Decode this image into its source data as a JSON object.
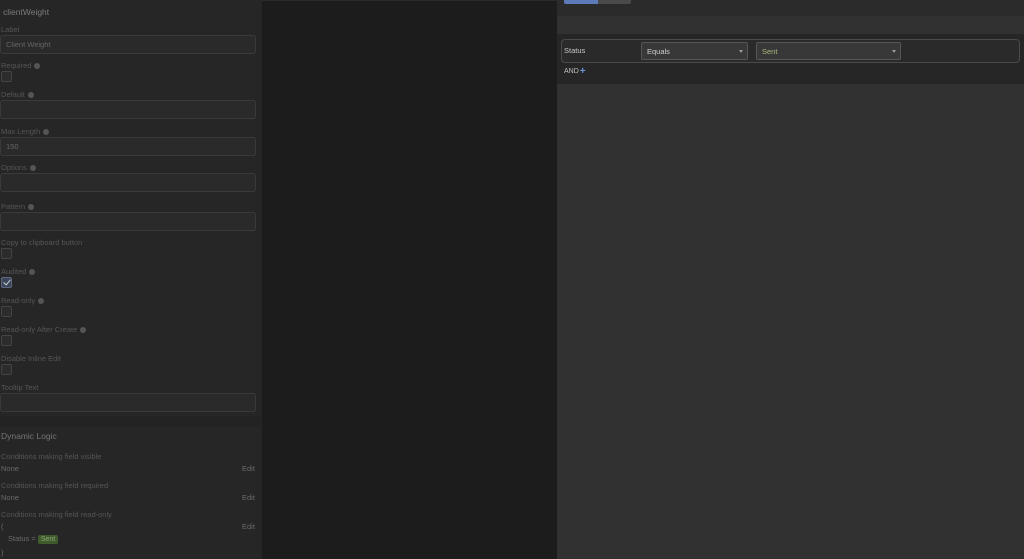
{
  "field": {
    "name": "clientWeight",
    "label_caption": "Label",
    "label_value": "Client Weight",
    "required_caption": "Required",
    "default_caption": "Default",
    "default_value": "",
    "maxlength_caption": "Max Length",
    "maxlength_value": "150",
    "options_caption": "Options",
    "pattern_caption": "Pattern",
    "copy_caption": "Copy to clipboard button",
    "audited_caption": "Audited",
    "readonly_caption": "Read-only",
    "readonly_after_caption": "Read-only After Create",
    "disable_inline_caption": "Disable Inline Edit",
    "tooltip_caption": "Tooltip Text",
    "audited_checked": true
  },
  "dynamic": {
    "title": "Dynamic Logic",
    "visible_caption": "Conditions making field visible",
    "visible_value": "None",
    "required_caption": "Conditions making field required",
    "required_value": "None",
    "readonly_caption": "Conditions making field read-only",
    "readonly_open": "(",
    "readonly_expr_field": "Status",
    "readonly_expr_op": "=",
    "readonly_expr_value": "Sent",
    "readonly_close": ")",
    "edit_label": "Edit"
  },
  "condition": {
    "field": "Status",
    "operator": "Equals",
    "value": "Sent",
    "and_label": "AND"
  },
  "colors": {
    "accent": "#5b7cb8",
    "badge_bg": "#3f5a2d",
    "value_text": "#a7b87a"
  }
}
